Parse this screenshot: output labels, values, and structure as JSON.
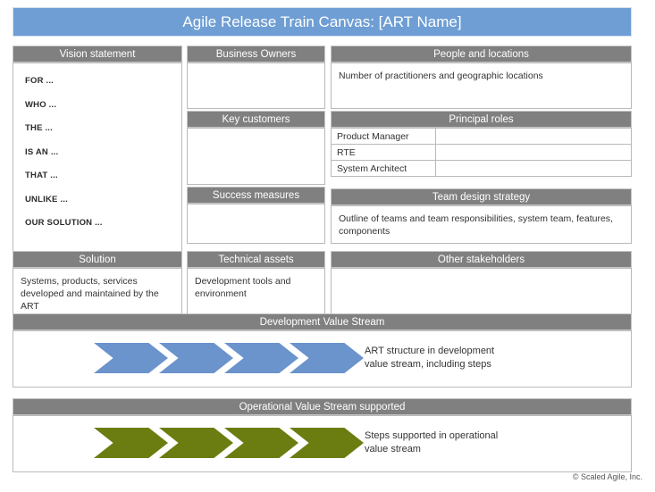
{
  "title": "Agile Release Train Canvas: [ART Name]",
  "colors": {
    "title_bar": "#6e9ed4",
    "panel_header": "#808080",
    "development_chevron": "#6b93cc",
    "operational_chevron": "#6b7d11"
  },
  "panels": {
    "vision_statement": {
      "header": "Vision statement",
      "lines": [
        "FOR ...",
        "WHO ...",
        "THE ...",
        "IS AN ...",
        "THAT ...",
        "UNLIKE ...",
        "OUR SOLUTION ..."
      ]
    },
    "business_owners": {
      "header": "Business Owners",
      "body": ""
    },
    "key_customers": {
      "header": "Key customers",
      "body": ""
    },
    "success_measures": {
      "header": "Success measures",
      "body": ""
    },
    "solution": {
      "header": "Solution",
      "body": "Systems, products, services developed and maintained by the ART"
    },
    "technical_assets": {
      "header": "Technical assets",
      "body": "Development tools and environment"
    },
    "people_and_locations": {
      "header": "People and locations",
      "body": "Number of practitioners and geographic locations"
    },
    "principal_roles": {
      "header": "Principal roles",
      "rows": [
        {
          "role": "Product Manager",
          "value": ""
        },
        {
          "role": "RTE",
          "value": ""
        },
        {
          "role": "System Architect",
          "value": ""
        }
      ]
    },
    "team_design_strategy": {
      "header": "Team design strategy",
      "body": "Outline of teams and team responsibilities, system team, features, components"
    },
    "other_stakeholders": {
      "header": "Other stakeholders",
      "body": ""
    },
    "development_value_stream": {
      "header": "Development Value Stream",
      "caption_line1": "ART structure in development",
      "caption_line2": "value stream, including steps",
      "chevron_count": 4
    },
    "operational_value_stream": {
      "header": "Operational Value Stream supported",
      "caption_line1": "Steps supported in operational",
      "caption_line2": "value stream",
      "chevron_count": 4
    }
  },
  "copyright": "© Scaled Agile, Inc."
}
